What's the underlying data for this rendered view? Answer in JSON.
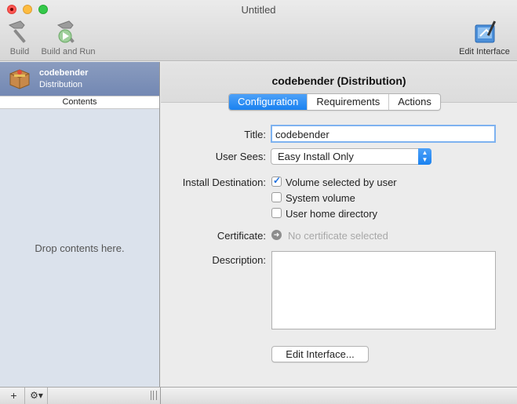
{
  "window": {
    "title": "Untitled"
  },
  "toolbar": {
    "build_label": "Build",
    "build_run_label": "Build and Run",
    "edit_interface_label": "Edit Interface"
  },
  "sidebar": {
    "selected_item": {
      "name": "codebender",
      "subtitle": "Distribution"
    },
    "contents_header": "Contents",
    "drop_hint": "Drop contents here."
  },
  "bottom_bar": {
    "add_symbol": "+",
    "gear_symbol": "⚙▾"
  },
  "main": {
    "heading": "codebender (Distribution)",
    "tabs": [
      {
        "label": "Configuration",
        "active": true
      },
      {
        "label": "Requirements",
        "active": false
      },
      {
        "label": "Actions",
        "active": false
      }
    ],
    "form": {
      "title_label": "Title:",
      "title_value": "codebender",
      "user_sees_label": "User Sees:",
      "user_sees_value": "Easy Install Only",
      "install_destination_label": "Install Destination:",
      "destinations": [
        {
          "label": "Volume selected by user",
          "checked": true
        },
        {
          "label": "System volume",
          "checked": false
        },
        {
          "label": "User home directory",
          "checked": false
        }
      ],
      "certificate_label": "Certificate:",
      "certificate_value": "No certificate selected",
      "description_label": "Description:",
      "description_value": "",
      "edit_interface_button": "Edit Interface..."
    }
  },
  "colors": {
    "accent": "#1a82f0",
    "sidebar_bg": "#dbe2ec",
    "selection": "#7a8db6"
  }
}
